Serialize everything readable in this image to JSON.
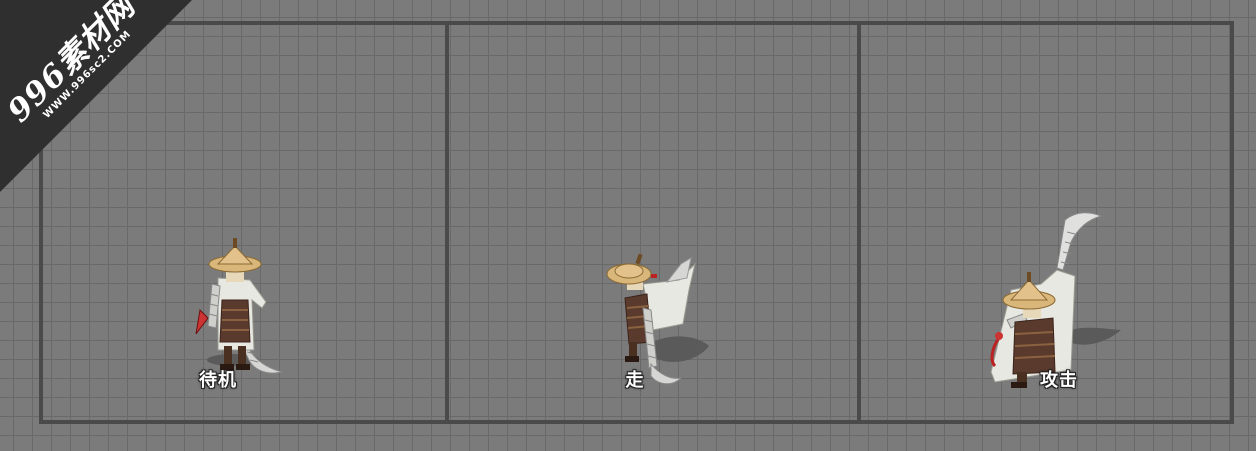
{
  "watermark": {
    "title": "996素材网",
    "url": "WWW.996sc2.COM"
  },
  "panels": [
    {
      "id": "idle",
      "label": "待机"
    },
    {
      "id": "walk",
      "label": "走"
    },
    {
      "id": "attack",
      "label": "攻击"
    }
  ],
  "colors": {
    "background": "#7b7b7b",
    "grid": "#696969",
    "frame": "#4a4a4a",
    "label": "#ffffff",
    "hat": "#d9b67a",
    "robe": "#e8e8e2",
    "armor": "#5a3a2c"
  }
}
